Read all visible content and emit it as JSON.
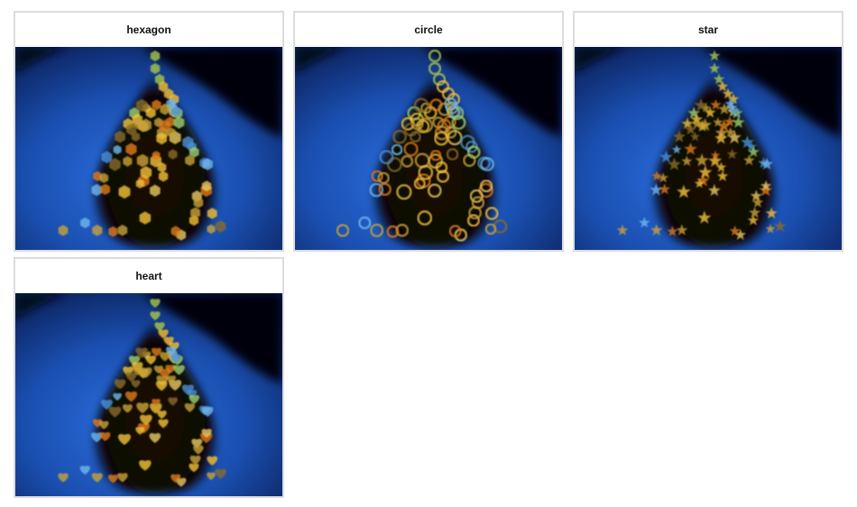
{
  "gallery": {
    "items": [
      {
        "id": "hexagon",
        "title": "hexagon",
        "shape": "hexagon",
        "image": "blurred christmas tree bokeh hexagon"
      },
      {
        "id": "circle",
        "title": "circle",
        "shape": "circle",
        "image": "blurred christmas tree bokeh circle"
      },
      {
        "id": "star",
        "title": "star",
        "shape": "star",
        "image": "blurred christmas tree bokeh star"
      },
      {
        "id": "heart",
        "title": "heart",
        "shape": "heart",
        "image": "blurred christmas tree bokeh heart"
      }
    ]
  },
  "colors": {
    "card_border": "#dcdcdc",
    "background_blue": "#1a4fb0",
    "background_dark": "#02040c",
    "light_warm": "#f2c23a",
    "light_orange": "#e07a1a",
    "light_cool": "#6fb8f0"
  }
}
